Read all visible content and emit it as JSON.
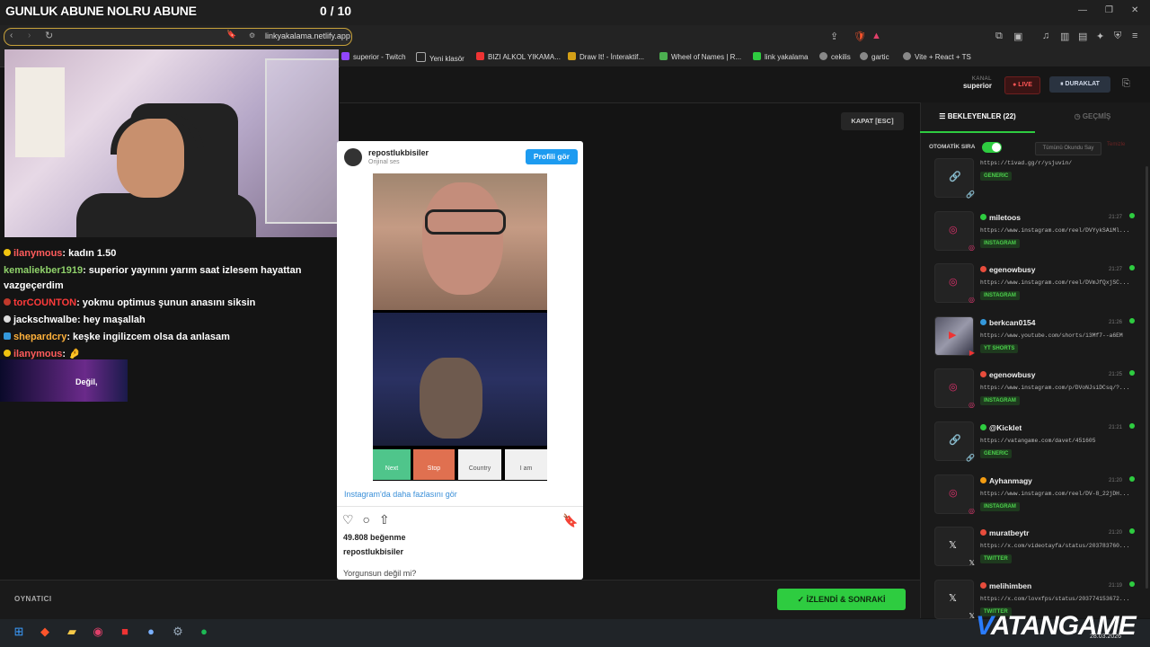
{
  "overlay": {
    "title": "GUNLUK ABUNE NOLRU ABUNE",
    "counter": "0 / 10"
  },
  "browser": {
    "url": "linkyakalama.netlify.app",
    "bookmarks": [
      "superior - Twitch",
      "Yeni klasör",
      "BIZI ALKOL YIKAMA...",
      "Draw It! - İnteraktif...",
      "Wheel of Names | R...",
      "link yakalama",
      "cekilis",
      "gartic",
      "Vite + React + TS"
    ]
  },
  "chat": [
    {
      "user": "ilanymous",
      "text": " kadın 1.50",
      "color": "#ff5c5c"
    },
    {
      "user": "kemaliekber1919",
      "text": " superior yayınını yarım saat izlesem hayattan vazgeçerdim",
      "color": "#8fd16a"
    },
    {
      "user": "torCOUNTON",
      "text": " yokmu optimus şunun anasını siksin",
      "color": "#ff3b3b"
    },
    {
      "user": "jackschwalbe",
      "text": " hey maşallah",
      "color": "#ffffff"
    },
    {
      "user": "shepardcry",
      "text": " keşke ingilizcem olsa da anlasam",
      "color": "#ffb13b"
    },
    {
      "user": "ilanymous",
      "text": " 🤌",
      "color": "#ff5c5c"
    }
  ],
  "banner": {
    "text": "Değil,"
  },
  "header": {
    "kanal_label": "KANAL",
    "kanal_value": "superior",
    "live": "● LIVE",
    "pause": "⏸ DURAKLAT",
    "close": "KAPAT [ESC]"
  },
  "instagram": {
    "user": "repostlukbisiler",
    "sub": "Orijinal ses",
    "profile_btn": "Profili gör",
    "buttons": [
      "Next",
      "Stop",
      "Country",
      "I am"
    ],
    "more": "Instagram'da daha fazlasını gör",
    "likes": "49.808 beğenme",
    "owner": "repostlukbisiler",
    "caption": "Yorgunsun değil mi?"
  },
  "panel": {
    "tab_waiting": "☰  BEKLEYENLER (22)",
    "tab_history": "◷  GEÇMİŞ",
    "auto_label": "OTOMATİK SIRA",
    "mark_all": "Tümünü Okundu Say",
    "clear": "Temizle",
    "items": [
      {
        "name": "",
        "url": "https://tivad.gg/r/ysjuvin/",
        "tag": "GENERIC",
        "time": "",
        "kind": "generic"
      },
      {
        "name": "miletoos",
        "url": "https://www.instagram.com/reel/DVYykSAiMl...",
        "tag": "INSTAGRAM",
        "time": "21:27",
        "kind": "instagram",
        "dot": "#2ecc40"
      },
      {
        "name": "egenowbusy",
        "url": "https://www.instagram.com/reel/DVmJfQxjSC...",
        "tag": "INSTAGRAM",
        "time": "21:27",
        "kind": "instagram",
        "dot": "#e74c3c"
      },
      {
        "name": "berkcan0154",
        "url": "https://www.youtube.com/shorts/i3Mf7--a6EM",
        "tag": "YT SHORTS",
        "time": "21:26",
        "kind": "youtube",
        "dot": "#3498db"
      },
      {
        "name": "egenowbusy",
        "url": "https://www.instagram.com/p/DVoNJsiDCsq/?...",
        "tag": "INSTAGRAM",
        "time": "21:25",
        "kind": "instagram",
        "dot": "#e74c3c"
      },
      {
        "name": "@Kicklet",
        "url": "https://vatangame.com/davet/451605",
        "tag": "GENERIC",
        "time": "21:21",
        "kind": "generic",
        "dot": "#2ecc40"
      },
      {
        "name": "Ayhanmagy",
        "url": "https://www.instagram.com/reel/DV-8_22jDH...",
        "tag": "INSTAGRAM",
        "time": "21:20",
        "kind": "instagram",
        "dot": "#f39c12"
      },
      {
        "name": "muratbeytr",
        "url": "https://x.com/videotayfa/status/203783760...",
        "tag": "TWITTER",
        "time": "21:20",
        "kind": "twitter",
        "dot": "#e74c3c"
      },
      {
        "name": "melihimben",
        "url": "https://x.com/lovxfps/status/203774153672...",
        "tag": "TWITTER",
        "time": "21:19",
        "kind": "twitter",
        "dot": "#e74c3c"
      }
    ]
  },
  "footer": {
    "label": "OYNATICI",
    "next": "✓  İZLENDİ & SONRAKİ"
  },
  "brand": {
    "a": "V",
    "b": "VATANGAME",
    "suffix": ".com"
  },
  "clock": "28.03.2026"
}
